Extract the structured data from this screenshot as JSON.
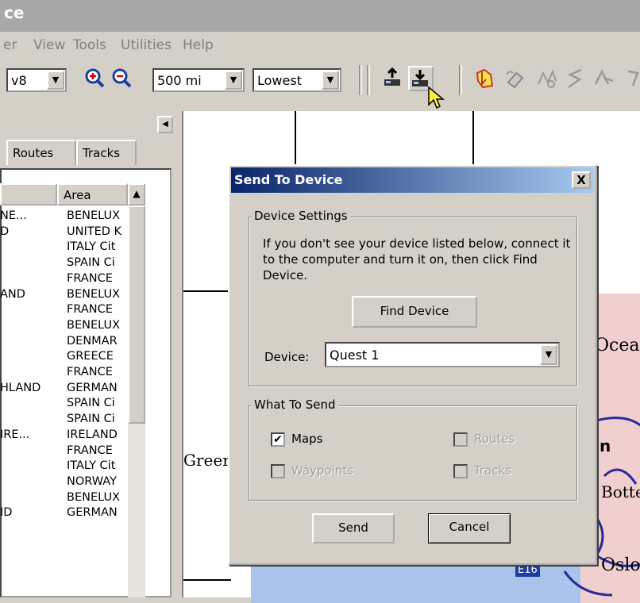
{
  "window": {
    "title": "ce"
  },
  "menu": {
    "items": [
      "er",
      "View",
      "Tools",
      "Utilities",
      "Help"
    ]
  },
  "toolbar": {
    "version_combo": "v8",
    "scale_combo": "500 mi",
    "detail_combo": "Lowest",
    "icons": [
      "zoom-in-icon",
      "zoom-out-icon",
      "receive-from-device-icon",
      "send-to-device-icon",
      "map-tool-icon",
      "eraser-icon",
      "select-tool-icon",
      "route-tool-icon"
    ]
  },
  "left_panel": {
    "tabs": [
      "Routes",
      "Tracks"
    ],
    "columns": [
      "",
      "Area"
    ],
    "rows": [
      {
        "name": "NE...",
        "area": "BENELUX"
      },
      {
        "name": "D",
        "area": "UNITED K"
      },
      {
        "name": "",
        "area": "ITALY Cit"
      },
      {
        "name": "",
        "area": "SPAIN Ci"
      },
      {
        "name": "",
        "area": "FRANCE"
      },
      {
        "name": "AND",
        "area": "BENELUX"
      },
      {
        "name": "",
        "area": "FRANCE"
      },
      {
        "name": "",
        "area": "BENELUX"
      },
      {
        "name": "",
        "area": "DENMAR"
      },
      {
        "name": "",
        "area": "GREECE"
      },
      {
        "name": "",
        "area": "FRANCE"
      },
      {
        "name": "HLAND",
        "area": "GERMAN"
      },
      {
        "name": "",
        "area": "SPAIN Ci"
      },
      {
        "name": "",
        "area": "SPAIN Ci"
      },
      {
        "name": "IRE...",
        "area": "IRELAND"
      },
      {
        "name": "",
        "area": "FRANCE"
      },
      {
        "name": "",
        "area": "ITALY Cit"
      },
      {
        "name": "",
        "area": "NORWAY"
      },
      {
        "name": "",
        "area": "BENELUX"
      },
      {
        "name": "ID",
        "area": "GERMAN"
      }
    ]
  },
  "map": {
    "labels": {
      "greenland": "Greer",
      "ocean": "Ocea",
      "n": "n",
      "botte": "Botte",
      "oslo": "Oslo",
      "road": "E16"
    },
    "colors": {
      "land": "#f2cfcf",
      "sea": "#a9c3ea",
      "border": "#2a2a9a"
    }
  },
  "dialog": {
    "title": "Send To Device",
    "close_label": "X",
    "device_settings": {
      "legend": "Device Settings",
      "instructions": "If you don't see your device listed below, connect it to the computer and turn it on, then click Find Device.",
      "find_button": "Find Device",
      "device_label": "Device:",
      "device_value": "Quest 1"
    },
    "what_to_send": {
      "legend": "What To Send",
      "maps": {
        "label": "Maps",
        "checked": "✔"
      },
      "waypoints": {
        "label": "Waypoints"
      },
      "routes": {
        "label": "Routes"
      },
      "tracks": {
        "label": "Tracks"
      }
    },
    "send_button": "Send",
    "cancel_button": "Cancel"
  }
}
